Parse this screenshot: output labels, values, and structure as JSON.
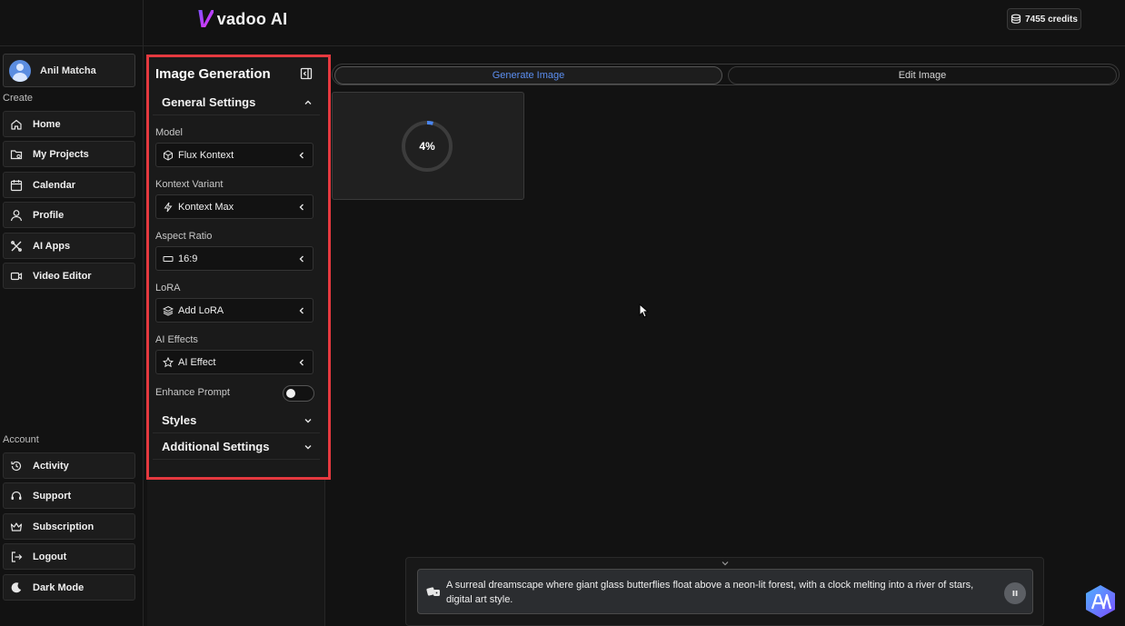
{
  "header": {
    "logo_mark": "V",
    "logo_text": "vadoo AI",
    "credits": "7455 credits"
  },
  "sidebar": {
    "user_name": "Anil Matcha",
    "create_label": "Create",
    "create_items": [
      {
        "label": "Home",
        "icon": "home-icon"
      },
      {
        "label": "My Projects",
        "icon": "folder-icon"
      },
      {
        "label": "Calendar",
        "icon": "calendar-icon"
      },
      {
        "label": "Profile",
        "icon": "user-icon"
      },
      {
        "label": "AI Apps",
        "icon": "tools-icon"
      },
      {
        "label": "Video Editor",
        "icon": "video-editor-icon"
      }
    ],
    "account_label": "Account",
    "account_items": [
      {
        "label": "Activity",
        "icon": "history-icon"
      },
      {
        "label": "Support",
        "icon": "headset-icon"
      },
      {
        "label": "Subscription",
        "icon": "crown-icon"
      },
      {
        "label": "Logout",
        "icon": "logout-icon"
      },
      {
        "label": "Dark Mode",
        "icon": "moon-icon"
      }
    ]
  },
  "panel": {
    "title": "Image Generation",
    "general_settings": "General Settings",
    "model_label": "Model",
    "model_value": "Flux Kontext",
    "variant_label": "Kontext Variant",
    "variant_value": "Kontext Max",
    "aspect_label": "Aspect Ratio",
    "aspect_value": "16:9",
    "lora_label": "LoRA",
    "lora_value": "Add LoRA",
    "effects_label": "AI Effects",
    "effects_value": "AI Effect",
    "enhance_label": "Enhance Prompt",
    "enhance_on": false,
    "styles": "Styles",
    "additional": "Additional Settings"
  },
  "tabs": {
    "generate": "Generate Image",
    "edit": "Edit Image",
    "active": "generate"
  },
  "generation": {
    "progress_text": "4%",
    "progress_fraction": 0.04
  },
  "prompt": {
    "text": "A surreal dreamscape where giant glass butterflies float above a neon-lit forest, with a clock melting into a river of stars, digital art style."
  },
  "colors": {
    "accent": "#5b8ef0",
    "highlight_border": "#e5393f",
    "background": "#121212"
  }
}
